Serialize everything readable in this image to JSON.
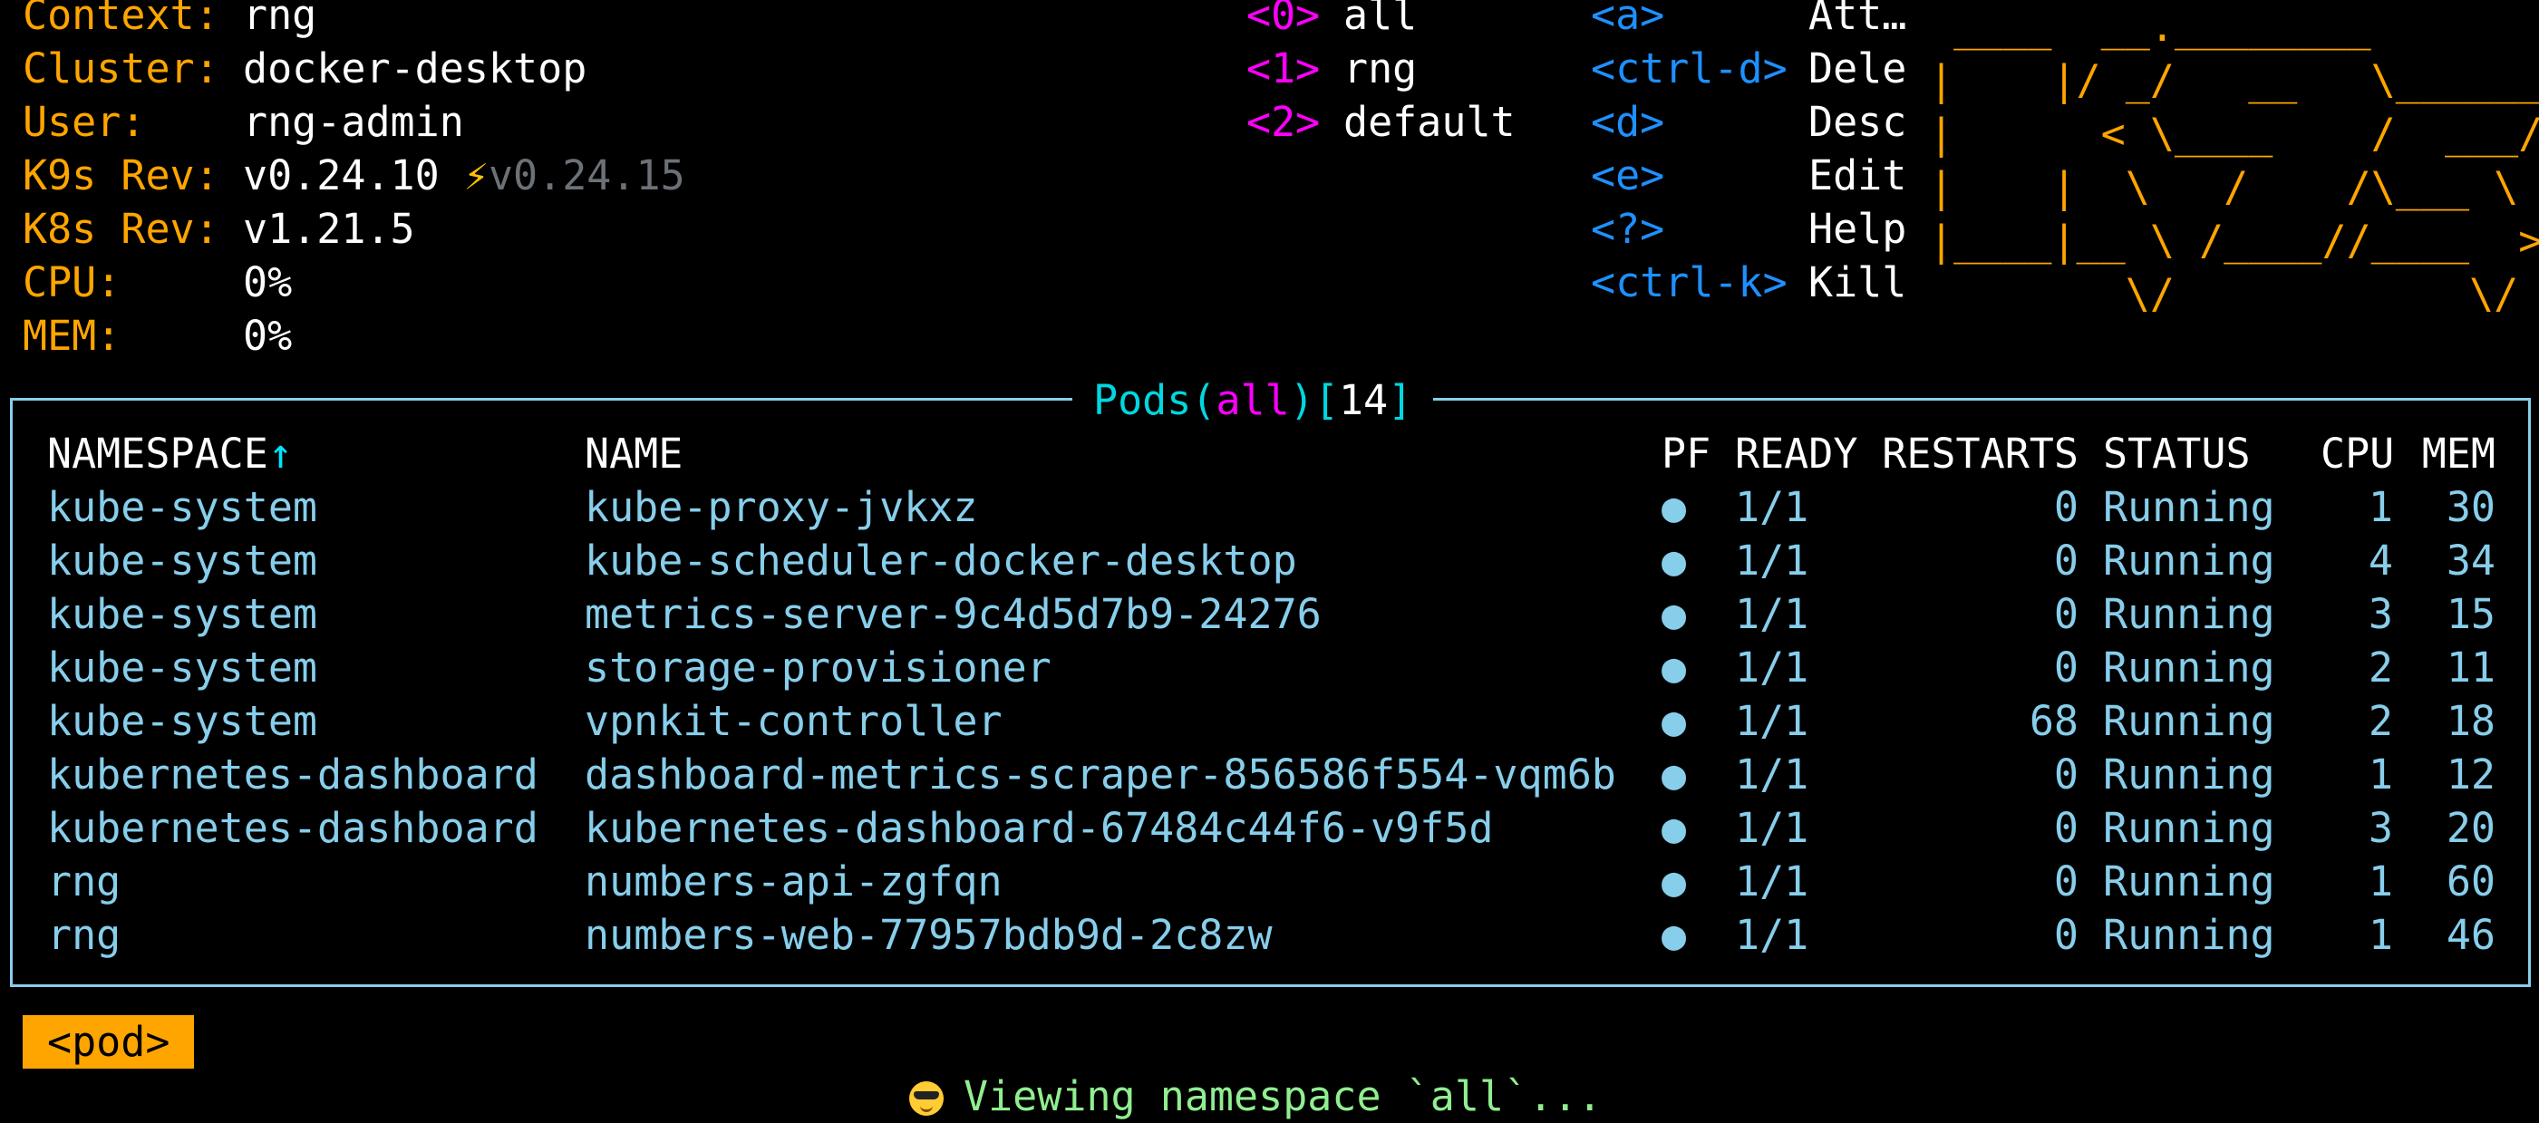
{
  "info": [
    {
      "label": "Context:",
      "value": "rng"
    },
    {
      "label": "Cluster:",
      "value": "docker-desktop"
    },
    {
      "label": "User:",
      "value": "rng-admin"
    },
    {
      "label": "K9s Rev:",
      "value": "v0.24.10",
      "upgrade": "v0.24.15"
    },
    {
      "label": "K8s Rev:",
      "value": "v1.21.5"
    },
    {
      "label": "CPU:",
      "value": "0%"
    },
    {
      "label": "MEM:",
      "value": "0%"
    }
  ],
  "namespaces": [
    {
      "key": "<0>",
      "label": "all"
    },
    {
      "key": "<1>",
      "label": "rng"
    },
    {
      "key": "<2>",
      "label": "default"
    }
  ],
  "hints": [
    {
      "key": "<a>",
      "label": "Att…"
    },
    {
      "key": "<ctrl-d>",
      "label": "Dele"
    },
    {
      "key": "<d>",
      "label": "Desc"
    },
    {
      "key": "<e>",
      "label": "Edit"
    },
    {
      "key": "<?>",
      "label": "Help"
    },
    {
      "key": "<ctrl-k>",
      "label": "Kill"
    }
  ],
  "logo": [
    " ____  __.________       ",
    "|    |/ _/   __   \\______",
    "|      < \\____    /  ___/",
    "|    |  \\   /    /\\___ \\ ",
    "|____|__ \\ /____//____  >",
    "        \\/            \\/ "
  ],
  "frame": {
    "resource": "Pods",
    "open_paren": "(",
    "namespace": "all",
    "close_paren": ")",
    "count_open": "[",
    "count": "14",
    "count_close": "]"
  },
  "table": {
    "headers": {
      "namespace": "NAMESPACE",
      "sort_indicator": "↑",
      "name": "NAME",
      "pf": "PF",
      "ready": "READY",
      "restarts": "RESTARTS",
      "status": "STATUS",
      "cpu": "CPU",
      "mem": "MEM"
    },
    "rows": [
      {
        "namespace": "kube-system",
        "name": "kube-proxy-jvkxz",
        "pf": "●",
        "ready": "1/1",
        "restarts": "0",
        "status": "Running",
        "cpu": "1",
        "mem": "30"
      },
      {
        "namespace": "kube-system",
        "name": "kube-scheduler-docker-desktop",
        "pf": "●",
        "ready": "1/1",
        "restarts": "0",
        "status": "Running",
        "cpu": "4",
        "mem": "34"
      },
      {
        "namespace": "kube-system",
        "name": "metrics-server-9c4d5d7b9-24276",
        "pf": "●",
        "ready": "1/1",
        "restarts": "0",
        "status": "Running",
        "cpu": "3",
        "mem": "15"
      },
      {
        "namespace": "kube-system",
        "name": "storage-provisioner",
        "pf": "●",
        "ready": "1/1",
        "restarts": "0",
        "status": "Running",
        "cpu": "2",
        "mem": "11"
      },
      {
        "namespace": "kube-system",
        "name": "vpnkit-controller",
        "pf": "●",
        "ready": "1/1",
        "restarts": "68",
        "status": "Running",
        "cpu": "2",
        "mem": "18"
      },
      {
        "namespace": "kubernetes-dashboard",
        "name": "dashboard-metrics-scraper-856586f554-vqm6b",
        "pf": "●",
        "ready": "1/1",
        "restarts": "0",
        "status": "Running",
        "cpu": "1",
        "mem": "12"
      },
      {
        "namespace": "kubernetes-dashboard",
        "name": "kubernetes-dashboard-67484c44f6-v9f5d",
        "pf": "●",
        "ready": "1/1",
        "restarts": "0",
        "status": "Running",
        "cpu": "3",
        "mem": "20"
      },
      {
        "namespace": "rng",
        "name": "numbers-api-zgfqn",
        "pf": "●",
        "ready": "1/1",
        "restarts": "0",
        "status": "Running",
        "cpu": "1",
        "mem": "60"
      },
      {
        "namespace": "rng",
        "name": "numbers-web-77957bdb9d-2c8zw",
        "pf": "●",
        "ready": "1/1",
        "restarts": "0",
        "status": "Running",
        "cpu": "1",
        "mem": "46"
      }
    ]
  },
  "crumb": "<pod>",
  "flash": "Viewing namespace `all`...",
  "icons": {
    "upgrade": "lightning-icon",
    "flash": "cool-face-icon"
  },
  "colors": {
    "accent": "#ffa500",
    "border": "#87ceeb",
    "hotkey": "#ff00ff",
    "hint": "#1e90ff",
    "flash": "#90ee90"
  }
}
